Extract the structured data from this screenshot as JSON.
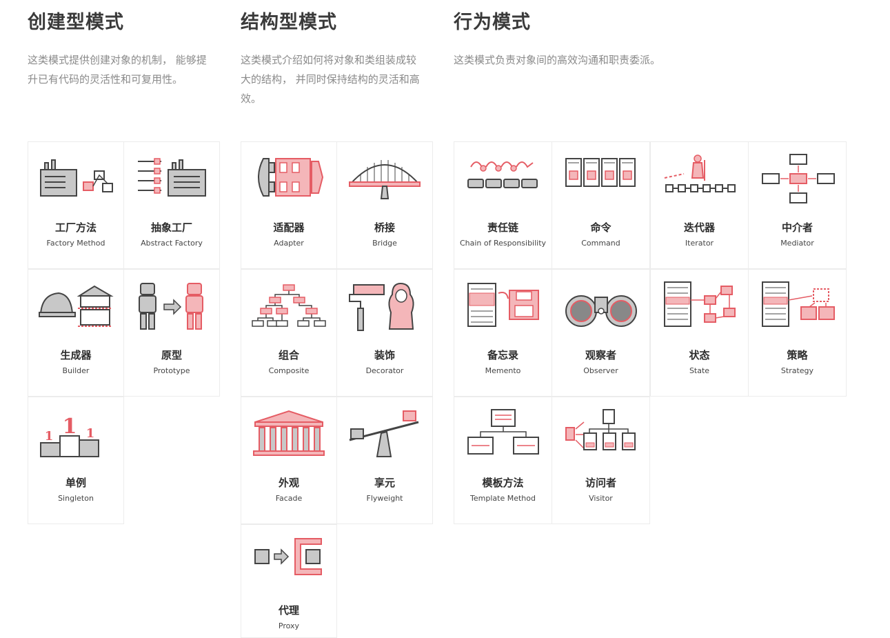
{
  "columns": [
    {
      "key": "creational",
      "title": "创建型模式",
      "desc_lines": [
        "这类模式提供创建对象的机制， 能够提",
        "升已有代码的灵活性和可复用性。"
      ],
      "cards": [
        {
          "zh": "工厂方法",
          "en": "Factory Method",
          "icon": "factory-method-icon"
        },
        {
          "zh": "抽象工厂",
          "en": "Abstract Factory",
          "icon": "abstract-factory-icon"
        },
        {
          "zh": "生成器",
          "en": "Builder",
          "icon": "builder-icon"
        },
        {
          "zh": "原型",
          "en": "Prototype",
          "icon": "prototype-icon"
        },
        {
          "zh": "单例",
          "en": "Singleton",
          "icon": "singleton-icon"
        }
      ]
    },
    {
      "key": "structural",
      "title": "结构型模式",
      "desc_lines": [
        "这类模式介绍如何将对象和类组装成较",
        "大的结构， 并同时保持结构的灵活和高",
        "效。"
      ],
      "cards": [
        {
          "zh": "适配器",
          "en": "Adapter",
          "icon": "adapter-icon"
        },
        {
          "zh": "桥接",
          "en": "Bridge",
          "icon": "bridge-icon"
        },
        {
          "zh": "组合",
          "en": "Composite",
          "icon": "composite-icon"
        },
        {
          "zh": "装饰",
          "en": "Decorator",
          "icon": "decorator-icon"
        },
        {
          "zh": "外观",
          "en": "Facade",
          "icon": "facade-icon"
        },
        {
          "zh": "享元",
          "en": "Flyweight",
          "icon": "flyweight-icon"
        },
        {
          "zh": "代理",
          "en": "Proxy",
          "icon": "proxy-icon"
        }
      ]
    },
    {
      "key": "behavioral",
      "title": "行为模式",
      "desc_lines": [
        "这类模式负责对象间的高效沟通和职责委派。"
      ],
      "cards": [
        {
          "zh": "责任链",
          "en": "Chain of Responsibility",
          "icon": "chain-icon"
        },
        {
          "zh": "命令",
          "en": "Command",
          "icon": "command-icon"
        },
        {
          "zh": "迭代器",
          "en": "Iterator",
          "icon": "iterator-icon"
        },
        {
          "zh": "中介者",
          "en": "Mediator",
          "icon": "mediator-icon"
        },
        {
          "zh": "备忘录",
          "en": "Memento",
          "icon": "memento-icon"
        },
        {
          "zh": "观察者",
          "en": "Observer",
          "icon": "observer-icon"
        },
        {
          "zh": "状态",
          "en": "State",
          "icon": "state-icon"
        },
        {
          "zh": "策略",
          "en": "Strategy",
          "icon": "strategy-icon"
        },
        {
          "zh": "模板方法",
          "en": "Template Method",
          "icon": "template-method-icon"
        },
        {
          "zh": "访问者",
          "en": "Visitor",
          "icon": "visitor-icon"
        }
      ]
    }
  ],
  "colors": {
    "accent": "#e55c64",
    "accent_fill": "#f4b6b9",
    "stroke": "#444444",
    "gray_fill": "#c8c8c8"
  }
}
